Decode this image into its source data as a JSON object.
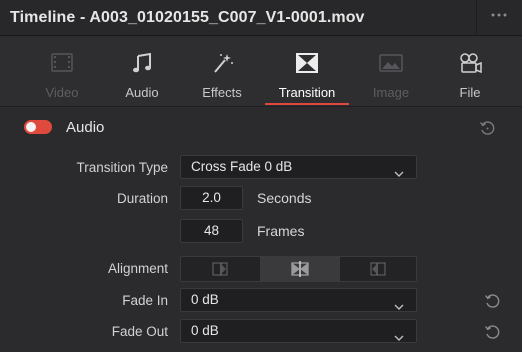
{
  "window": {
    "title": "Timeline - A003_01020155_C007_V1-0001.mov",
    "more_icon": "ellipsis-icon"
  },
  "tabs": [
    {
      "label": "Video",
      "icon": "film-icon",
      "state": "disabled"
    },
    {
      "label": "Audio",
      "icon": "music-note-icon",
      "state": "normal"
    },
    {
      "label": "Effects",
      "icon": "magic-wand-icon",
      "state": "normal"
    },
    {
      "label": "Transition",
      "icon": "transition-icon",
      "state": "active"
    },
    {
      "label": "Image",
      "icon": "image-icon",
      "state": "disabled"
    },
    {
      "label": "File",
      "icon": "file-projector-icon",
      "state": "normal"
    }
  ],
  "section": {
    "label": "Audio",
    "enabled": true
  },
  "fields": {
    "transition_type": {
      "label": "Transition Type",
      "value": "Cross Fade 0 dB"
    },
    "duration": {
      "label": "Duration",
      "seconds_value": "2.0",
      "seconds_unit": "Seconds",
      "frames_value": "48",
      "frames_unit": "Frames"
    },
    "alignment": {
      "label": "Alignment",
      "options": [
        "start-on-edit",
        "center-on-edit",
        "end-on-edit"
      ],
      "selected": "center-on-edit"
    },
    "fade_in": {
      "label": "Fade In",
      "value": "0 dB"
    },
    "fade_out": {
      "label": "Fade Out",
      "value": "0 dB"
    }
  },
  "colors": {
    "accent": "#e0473f",
    "background": "#2b2b2e",
    "field_bg": "#1f1f21"
  }
}
